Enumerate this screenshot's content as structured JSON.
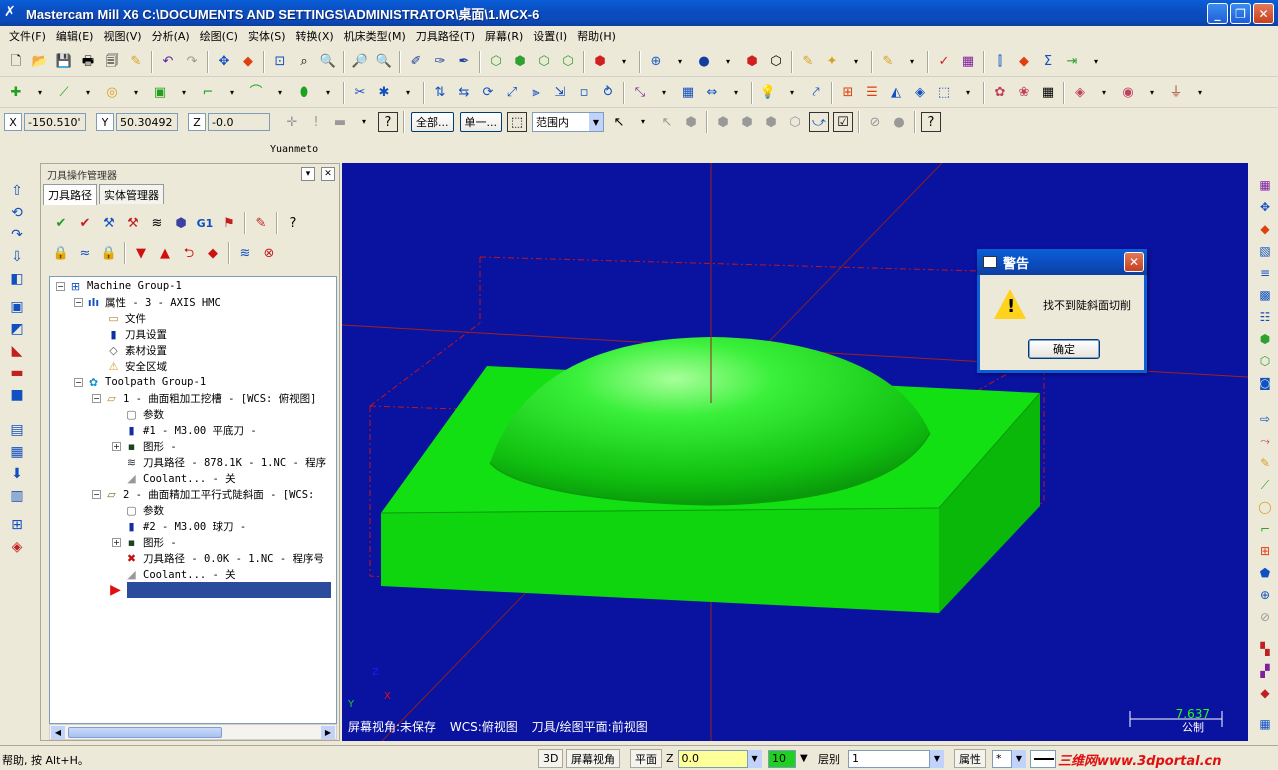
{
  "window": {
    "title": "Mastercam Mill X6  C:\\DOCUMENTS AND SETTINGS\\ADMINISTRATOR\\桌面\\1.MCX-6",
    "minimize": "_",
    "restore": "❐",
    "close": "✕"
  },
  "menu": [
    "文件(F)",
    "编辑(E)",
    "视图(V)",
    "分析(A)",
    "绘图(C)",
    "实体(S)",
    "转换(X)",
    "机床类型(M)",
    "刀具路径(T)",
    "屏幕(R)",
    "设置(I)",
    "帮助(H)"
  ],
  "coords": {
    "x_label": "X",
    "x_value": "-150.510'",
    "y_label": "Y",
    "y_value": "50.30492",
    "z_label": "Z",
    "z_value": "-0.0",
    "all_button": "全部...",
    "single_button": "单一...",
    "range_select": "范围内"
  },
  "label_bar": "Yuanmeto",
  "ops_manager": {
    "title": "刀具操作管理器",
    "pin": "▾",
    "close": "✕",
    "tabs": [
      "刀具路径",
      "实体管理器"
    ],
    "toolbar_g1": "G1",
    "tree": [
      {
        "indent": 0,
        "exp": "−",
        "icon": "⊞",
        "text": "Machine Group-1"
      },
      {
        "indent": 1,
        "exp": "−",
        "icon": "ılı",
        "text": "属性 - 3 - AXIS HMC"
      },
      {
        "indent": 2,
        "exp": "",
        "icon": "▭",
        "text": "文件"
      },
      {
        "indent": 2,
        "exp": "",
        "icon": "▮",
        "text": "刀具设置"
      },
      {
        "indent": 2,
        "exp": "",
        "icon": "◇",
        "text": "素材设置"
      },
      {
        "indent": 2,
        "exp": "",
        "icon": "⚠",
        "text": "安全区域"
      },
      {
        "indent": 1,
        "exp": "−",
        "icon": "✿",
        "text": "Toolpath Group-1"
      },
      {
        "indent": 2,
        "exp": "−",
        "icon": "▱",
        "text": "1 - 曲面粗加工挖槽 - [WCS: 俯视图]"
      },
      {
        "indent": 3,
        "exp": "",
        "icon": "▢",
        "text": "参数"
      },
      {
        "indent": 3,
        "exp": "",
        "icon": "▮",
        "text": "#1 - M3.00 平底刀 -"
      },
      {
        "indent": 3,
        "exp": "+",
        "icon": "▪",
        "text": "图形 -"
      },
      {
        "indent": 3,
        "exp": "",
        "icon": "≋",
        "text": "刀具路径 - 878.1K - 1.NC - 程序"
      },
      {
        "indent": 3,
        "exp": "",
        "icon": "◢",
        "text": "Coolant... - 关"
      },
      {
        "indent": 2,
        "exp": "−",
        "icon": "▱",
        "text": "2 - 曲面精加工平行式陡斜面 - [WCS:"
      },
      {
        "indent": 3,
        "exp": "",
        "icon": "▢",
        "text": "参数"
      },
      {
        "indent": 3,
        "exp": "",
        "icon": "▮",
        "text": "#2 - M3.00 球刀 -"
      },
      {
        "indent": 3,
        "exp": "+",
        "icon": "▪",
        "text": "图形 -"
      },
      {
        "indent": 3,
        "exp": "",
        "icon": "✖",
        "text": "刀具路径 - 0.0K - 1.NC - 程序号"
      },
      {
        "indent": 3,
        "exp": "",
        "icon": "◢",
        "text": "Coolant... - 关"
      }
    ]
  },
  "viewport": {
    "background": "#0A12A0",
    "status": [
      "屏幕视角:未保存",
      "WCS:俯视图",
      "刀具/绘图平面:前视图"
    ],
    "scale_value": "7.637",
    "scale_unit": "公制",
    "axis_y": "Y",
    "axis_x": "X",
    "axis_z": "Z"
  },
  "dialog": {
    "title": "警告",
    "message": "找不到陡斜面切削",
    "ok": "确定",
    "close": "✕"
  },
  "statusbar": {
    "help": "帮助, 按 Alt+H。",
    "mode3d": "3D",
    "screen_view": "屏幕视角",
    "plane": "平面",
    "z_label": "Z",
    "z_value": "0.0",
    "color_value": "10",
    "level_label": "层别",
    "level_value": "1",
    "attr_label": "属性",
    "star": "*",
    "watermark": "三维网www.3dportal.cn"
  },
  "colors": {
    "title_blue": "#0A5FD8",
    "viewport_blue": "#0A12A0",
    "model_green": "#12E012",
    "grid_red": "#C81414",
    "scale_green": "#20FF20"
  }
}
